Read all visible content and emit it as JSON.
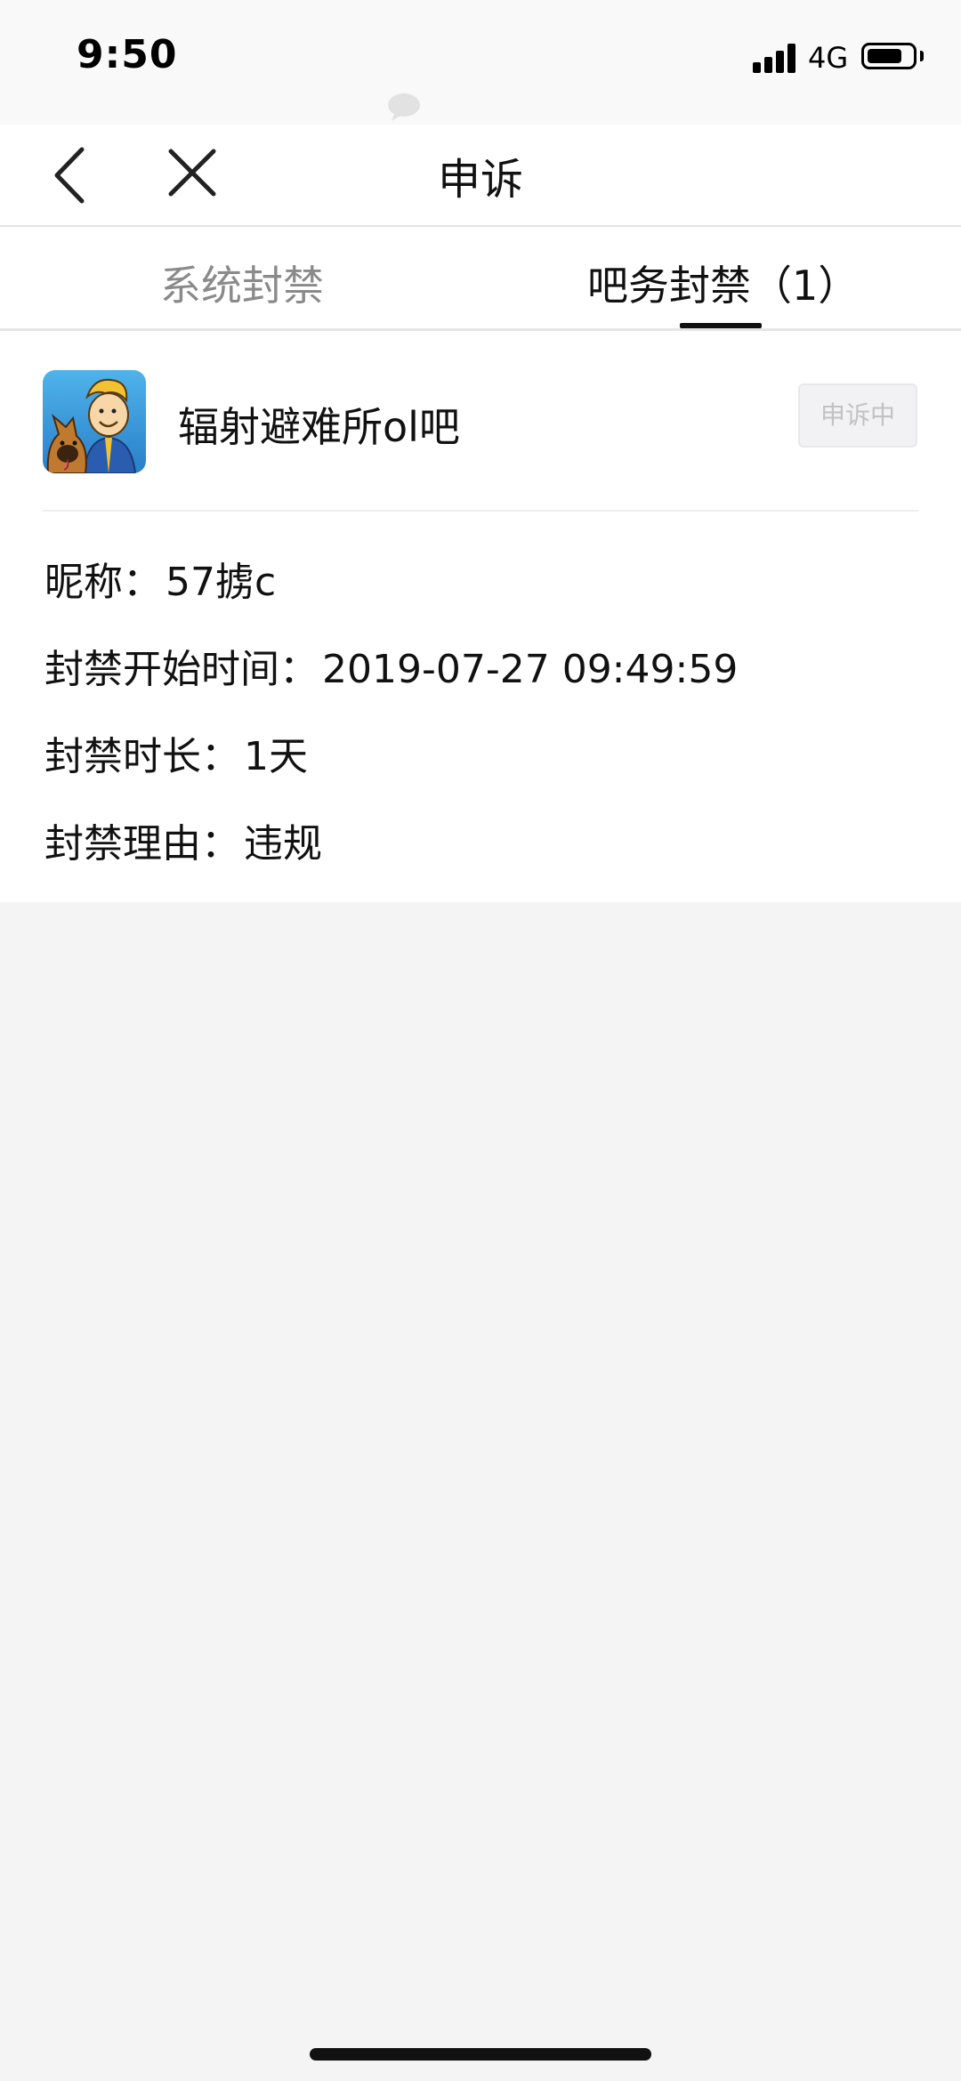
{
  "status_bar": {
    "time": "9:50",
    "network": "4G"
  },
  "nav": {
    "title": "申诉"
  },
  "tabs": [
    {
      "label": "系统封禁",
      "active": false
    },
    {
      "label": "吧务封禁（1）",
      "active": true
    }
  ],
  "ban": {
    "forum_name": "辐射避难所ol吧",
    "status": "申诉中",
    "nickname_label": "昵称：",
    "nickname": "57掳c",
    "start_label": "封禁开始时间：",
    "start_time": "2019-07-27 09:49:59",
    "duration_label": "封禁时长：",
    "duration": "1天",
    "reason_label": "封禁理由：",
    "reason": "违规"
  },
  "icons": {
    "back": "chevron-left-icon",
    "close": "close-icon",
    "chat": "chat-bubble-icon",
    "signal": "signal-icon",
    "battery": "battery-icon",
    "avatar": "forum-avatar-vault-boy"
  },
  "colors": {
    "page_bg": "#f4f4f4",
    "active_tab": "#111111",
    "inactive_tab": "#8a8a8a",
    "badge_bg": "#f2f2f4",
    "badge_text": "#c2c2c6"
  }
}
